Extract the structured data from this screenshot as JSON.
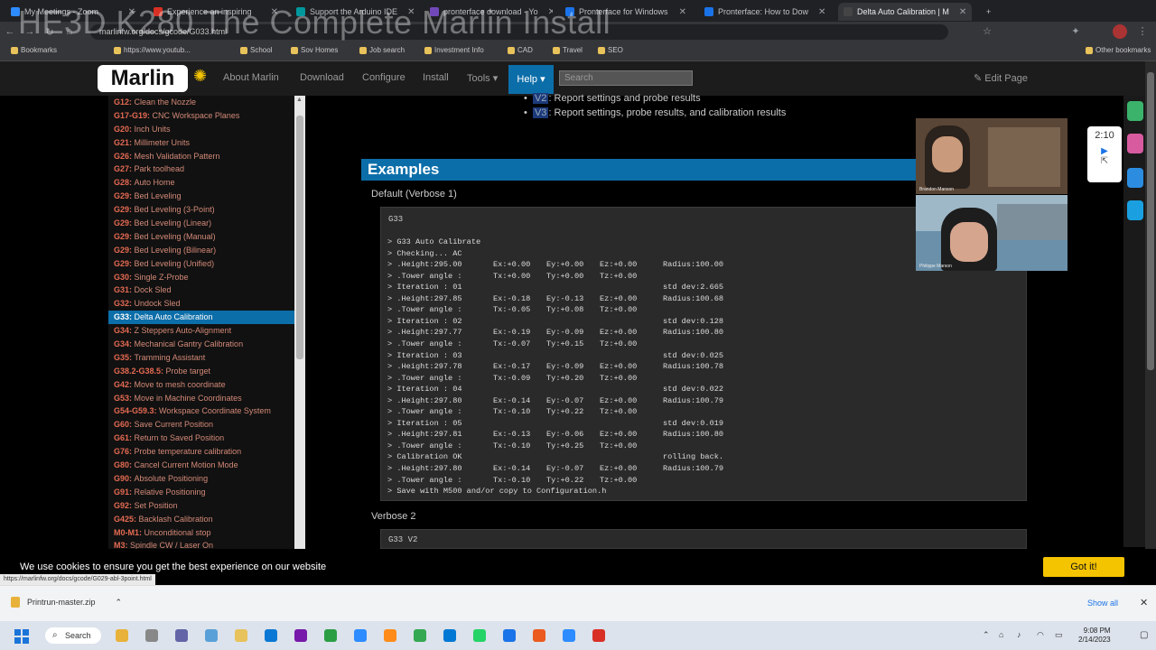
{
  "watermark": "HE3D K280 The Complete Marlin Install",
  "browser": {
    "tabs": [
      {
        "title": "My Meetings - Zoom",
        "color": "#2d8cff"
      },
      {
        "title": "Experience an inspiring",
        "color": "#d93025"
      },
      {
        "title": "Support the Arduino IDE",
        "color": "#00979d"
      },
      {
        "title": "pronterface download - Yo",
        "color": "#7248b9"
      },
      {
        "title": "Pronterface for Windows",
        "color": "#1a73e8"
      },
      {
        "title": "Pronterface: How to Dow",
        "color": "#1a73e8"
      },
      {
        "title": "Delta Auto Calibration | M",
        "color": "#444444"
      }
    ],
    "new_tab": "+",
    "url": "marlinfw.org/docs/gcode/G033.html",
    "bookmarks": [
      "Bookmarks",
      "https://www.youtub...",
      "School",
      "Sov Homes",
      "Job search",
      "Investment Info",
      "CAD",
      "Travel",
      "SEO",
      "Other bookmarks"
    ]
  },
  "site": {
    "logo": "Marlin",
    "nav": [
      "About Marlin",
      "Download",
      "Configure",
      "Install",
      "Tools"
    ],
    "help": "Help",
    "search_placeholder": "Search",
    "edit_page": "Edit Page"
  },
  "sidebar": {
    "items": [
      {
        "code": "G12",
        "label": "Clean the Nozzle"
      },
      {
        "code": "G17-G19",
        "label": "CNC Workspace Planes"
      },
      {
        "code": "G20",
        "label": "Inch Units"
      },
      {
        "code": "G21",
        "label": "Millimeter Units"
      },
      {
        "code": "G26",
        "label": "Mesh Validation Pattern"
      },
      {
        "code": "G27",
        "label": "Park toolhead"
      },
      {
        "code": "G28",
        "label": "Auto Home"
      },
      {
        "code": "G29",
        "label": "Bed Leveling"
      },
      {
        "code": "G29",
        "label": "Bed Leveling (3-Point)"
      },
      {
        "code": "G29",
        "label": "Bed Leveling (Linear)"
      },
      {
        "code": "G29",
        "label": "Bed Leveling (Manual)"
      },
      {
        "code": "G29",
        "label": "Bed Leveling (Bilinear)"
      },
      {
        "code": "G29",
        "label": "Bed Leveling (Unified)"
      },
      {
        "code": "G30",
        "label": "Single Z-Probe"
      },
      {
        "code": "G31",
        "label": "Dock Sled"
      },
      {
        "code": "G32",
        "label": "Undock Sled"
      },
      {
        "code": "G33",
        "label": "Delta Auto Calibration"
      },
      {
        "code": "G34",
        "label": "Z Steppers Auto-Alignment"
      },
      {
        "code": "G34",
        "label": "Mechanical Gantry Calibration"
      },
      {
        "code": "G35",
        "label": "Tramming Assistant"
      },
      {
        "code": "G38.2-G38.5",
        "label": "Probe target"
      },
      {
        "code": "G42",
        "label": "Move to mesh coordinate"
      },
      {
        "code": "G53",
        "label": "Move in Machine Coordinates"
      },
      {
        "code": "G54-G59.3",
        "label": "Workspace Coordinate System"
      },
      {
        "code": "G60",
        "label": "Save Current Position"
      },
      {
        "code": "G61",
        "label": "Return to Saved Position"
      },
      {
        "code": "G76",
        "label": "Probe temperature calibration"
      },
      {
        "code": "G80",
        "label": "Cancel Current Motion Mode"
      },
      {
        "code": "G90",
        "label": "Absolute Positioning"
      },
      {
        "code": "G91",
        "label": "Relative Positioning"
      },
      {
        "code": "G92",
        "label": "Set Position"
      },
      {
        "code": "G425",
        "label": "Backlash Calibration"
      },
      {
        "code": "M0-M1",
        "label": "Unconditional stop"
      },
      {
        "code": "M3",
        "label": "Spindle CW / Laser On"
      }
    ],
    "active_index": 16
  },
  "main": {
    "bullets": [
      {
        "tag": "V2",
        "text": ": Report settings and probe results"
      },
      {
        "tag": "V3",
        "text": ": Report settings, probe results, and calibration results"
      }
    ],
    "examples_heading": "Examples",
    "default_label": "Default (Verbose 1)",
    "code1_header": "G33",
    "code_lines": [
      [
        "> G33 Auto Calibrate",
        "",
        "",
        "",
        ""
      ],
      [
        "> Checking... AC",
        "",
        "",
        "",
        ""
      ],
      [
        "> .Height:295.00",
        "Ex:+0.00",
        "Ey:+0.00",
        "Ez:+0.00",
        "Radius:100.00"
      ],
      [
        "> .Tower angle :",
        "Tx:+0.00",
        "Ty:+0.00",
        "Tz:+0.00",
        ""
      ],
      [
        "> Iteration : 01",
        "",
        "",
        "",
        "std dev:2.665"
      ],
      [
        "> .Height:297.85",
        "Ex:-0.18",
        "Ey:-0.13",
        "Ez:+0.00",
        "Radius:100.68"
      ],
      [
        "> .Tower angle :",
        "Tx:-0.05",
        "Ty:+0.08",
        "Tz:+0.00",
        ""
      ],
      [
        "> Iteration : 02",
        "",
        "",
        "",
        "std dev:0.128"
      ],
      [
        "> .Height:297.77",
        "Ex:-0.19",
        "Ey:-0.09",
        "Ez:+0.00",
        "Radius:100.80"
      ],
      [
        "> .Tower angle :",
        "Tx:-0.07",
        "Ty:+0.15",
        "Tz:+0.00",
        ""
      ],
      [
        "> Iteration : 03",
        "",
        "",
        "",
        "std dev:0.025"
      ],
      [
        "> .Height:297.78",
        "Ex:-0.17",
        "Ey:-0.09",
        "Ez:+0.00",
        "Radius:100.78"
      ],
      [
        "> .Tower angle :",
        "Tx:-0.09",
        "Ty:+0.20",
        "Tz:+0.00",
        ""
      ],
      [
        "> Iteration : 04",
        "",
        "",
        "",
        "std dev:0.022"
      ],
      [
        "> .Height:297.80",
        "Ex:-0.14",
        "Ey:-0.07",
        "Ez:+0.00",
        "Radius:100.79"
      ],
      [
        "> .Tower angle :",
        "Tx:-0.10",
        "Ty:+0.22",
        "Tz:+0.00",
        ""
      ],
      [
        "> Iteration : 05",
        "",
        "",
        "",
        "std dev:0.019"
      ],
      [
        "> .Height:297.81",
        "Ex:-0.13",
        "Ey:-0.06",
        "Ez:+0.00",
        "Radius:100.80"
      ],
      [
        "> .Tower angle :",
        "Tx:-0.10",
        "Ty:+0.25",
        "Tz:+0.00",
        ""
      ],
      [
        "> Calibration OK",
        "",
        "",
        "",
        "rolling back."
      ],
      [
        "> .Height:297.80",
        "Ex:-0.14",
        "Ey:-0.07",
        "Ez:+0.00",
        "Radius:100.79"
      ],
      [
        "> .Tower angle :",
        "Tx:-0.10",
        "Ty:+0.22",
        "Tz:+0.00",
        ""
      ],
      [
        "> Save with M500 and/or copy to Configuration.h",
        "",
        "",
        "",
        ""
      ]
    ],
    "verbose2_label": "Verbose 2",
    "code2_header": "G33 V2"
  },
  "video": {
    "timer": "2:10",
    "participant1": "Brandon Manson",
    "participant2": "Philippe Marson"
  },
  "cookie": {
    "text": "We use cookies to ensure you get the best experience on our website",
    "button": "Got it!"
  },
  "status_url": "https://marlinfw.org/docs/gcode/G029-abl-3point.html",
  "downloads": {
    "file": "Printrun-master.zip",
    "show_all": "Show all"
  },
  "taskbar": {
    "search": "Search",
    "time": "9:08 PM",
    "date": "2/14/2023"
  }
}
